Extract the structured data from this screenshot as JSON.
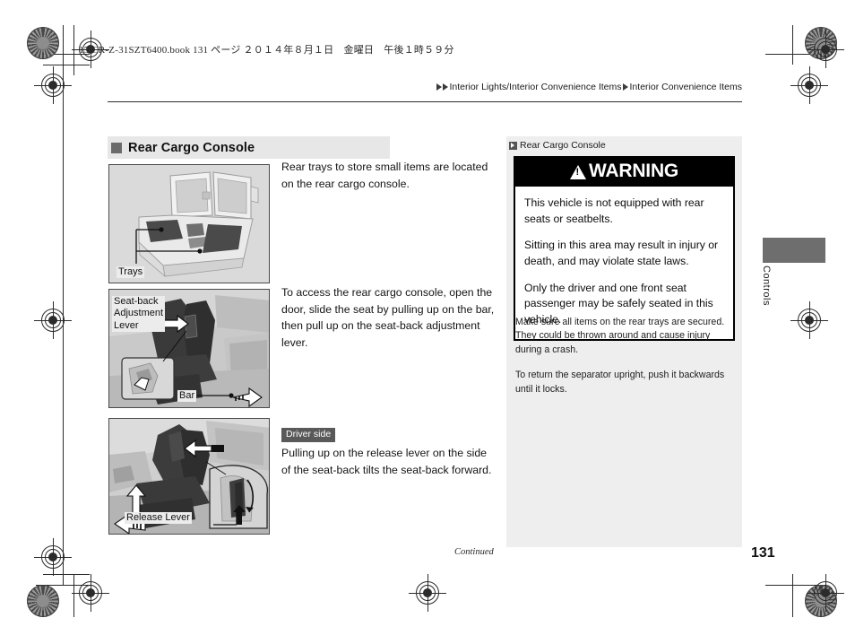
{
  "document": {
    "header_line": "15 CR-Z-31SZT6400.book  131 ページ  ２０１４年８月１日　金曜日　午後１時５９分",
    "page_number": "131",
    "continued_label": "Continued",
    "thumb_tab_label": "Controls"
  },
  "breadcrumb": {
    "level1": "Interior Lights/Interior Convenience Items",
    "level2": "Interior Convenience Items"
  },
  "section": {
    "title": "Rear Cargo Console"
  },
  "body": {
    "paragraph1": "Rear trays to store small items are located on the rear cargo console.",
    "paragraph2": "To access the rear cargo console, open the door, slide the seat by pulling up on the bar, then pull up on the seat-back adjustment lever.",
    "driver_side_badge": "Driver side",
    "paragraph3": "Pulling up on the release lever on the side of the seat-back tilts the seat-back forward."
  },
  "figures": {
    "figure1": {
      "label_trays": "Trays"
    },
    "figure2": {
      "label_lever": "Seat-back\nAdjustment\nLever",
      "label_bar": "Bar"
    },
    "figure3": {
      "label_release": "Release Lever"
    }
  },
  "side_panel": {
    "heading": "Rear Cargo Console",
    "warning_title": "WARNING",
    "warning_paragraphs": [
      "This vehicle is not equipped with rear seats or seatbelts.",
      "Sitting in this area may result in injury or death, and may violate state laws.",
      "Only the driver and one front seat passenger may be safely seated in this vehicle."
    ],
    "notes": [
      "Make sure all items on the rear trays are secured. They could be thrown around and cause injury during a crash.",
      "To return the separator upright, push it backwards until it locks."
    ]
  },
  "colors": {
    "section_bar": "#e7e7e7",
    "panel_bg": "#eeeeee",
    "warning_bg": "#000000",
    "badge_bg": "#595959",
    "thumb_tab": "#6e6e6e"
  }
}
